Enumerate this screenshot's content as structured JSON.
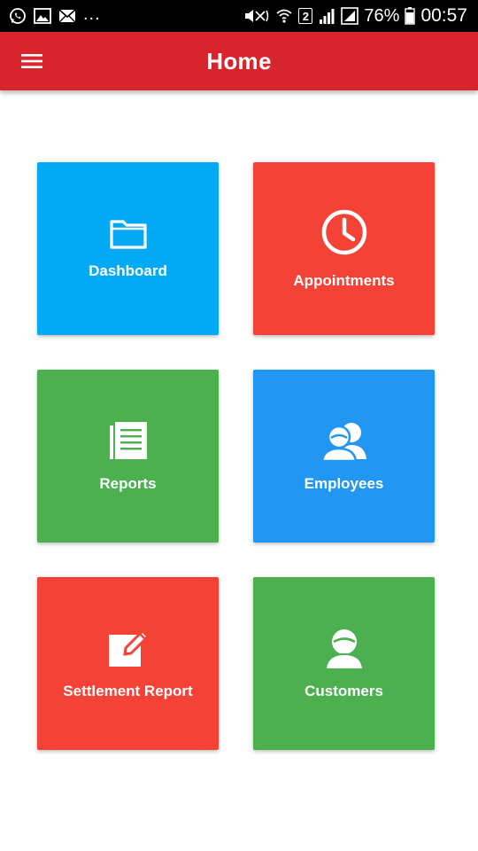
{
  "status_bar": {
    "dots": "...",
    "sim_badge": "2",
    "battery": "76%",
    "time": "00:57"
  },
  "app_bar": {
    "title": "Home"
  },
  "tiles": [
    {
      "label": "Dashboard",
      "icon": "folder-icon",
      "color": "#03a9f4"
    },
    {
      "label": "Appointments",
      "icon": "clock-icon",
      "color": "#f44336"
    },
    {
      "label": "Reports",
      "icon": "document-icon",
      "color": "#4caf50"
    },
    {
      "label": "Employees",
      "icon": "users-icon",
      "color": "#2196f3"
    },
    {
      "label": "Settlement Report",
      "icon": "edit-icon",
      "color": "#f44336"
    },
    {
      "label": "Customers",
      "icon": "user-icon",
      "color": "#4caf50"
    }
  ],
  "colors": {
    "app_bar": "#d8242c",
    "status_bar": "#000000",
    "background": "#ffffff"
  }
}
